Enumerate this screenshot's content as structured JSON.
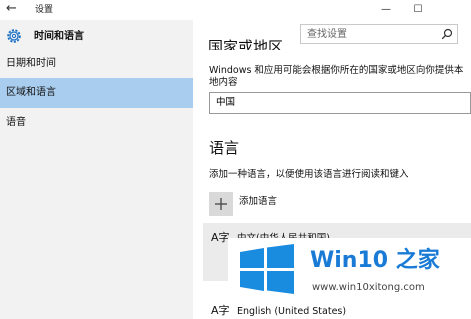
{
  "window": {
    "back_glyph": "←",
    "title": "设置",
    "minimize_glyph": "—",
    "maximize_glyph": "☐"
  },
  "sidebar": {
    "header_label": "时间和语言",
    "items": [
      {
        "label": "日期和时间",
        "active": false
      },
      {
        "label": "区域和语言",
        "active": true
      },
      {
        "label": "语音",
        "active": false
      }
    ]
  },
  "search": {
    "placeholder": "查找设置"
  },
  "main": {
    "region_heading_partial": "国家或地区",
    "region_description": "Windows 和应用可能会根据你所在的国家或地区向你提供本地内容",
    "region_value": "中国",
    "languages_heading": "语言",
    "languages_description": "添加一种语言，以便使用该语言进行阅读和键入",
    "add_language_label": "添加语言",
    "add_glyph": "+",
    "language_items": [
      {
        "icon_glyph": "A字",
        "name": "中文(中华人民共和国)"
      },
      {
        "icon_glyph": "A字",
        "name": "English (United States)"
      }
    ]
  },
  "watermark": {
    "title": "Win10 之家",
    "url": "www.win10xitong.com",
    "logo_color": "#1a8ce0"
  }
}
